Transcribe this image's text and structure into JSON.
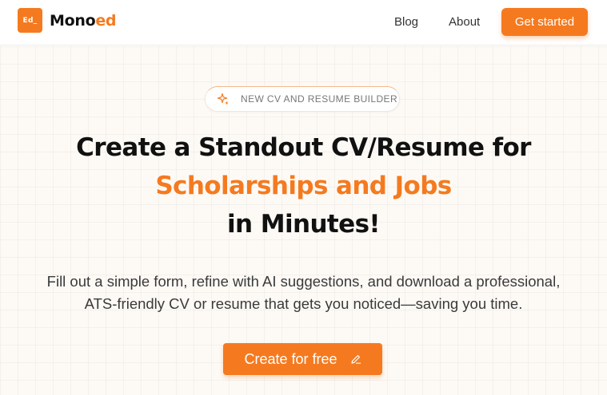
{
  "nav": {
    "logo_mark": "Ed_",
    "brand_main": "Mono",
    "brand_accent": "ed",
    "links": [
      "Blog",
      "About"
    ],
    "cta_label": "Get started"
  },
  "hero": {
    "badge_text": "NEW CV AND RESUME BUILDER",
    "badge_icon": "sparkle-icon",
    "headline_line1": "Create a Standout CV/Resume for",
    "headline_line2": "Scholarships and Jobs",
    "headline_line3": "in Minutes!",
    "subtext_line1": "Fill out a simple form, refine with AI suggestions, and download a professional,",
    "subtext_line2": "ATS-friendly CV or resume that gets you noticed—saving you time.",
    "cta_label": "Create for free",
    "cta_icon": "pencil-icon"
  },
  "colors": {
    "accent": "#f57a1f",
    "hero_bg": "#fdfaf6",
    "text": "#111111"
  }
}
